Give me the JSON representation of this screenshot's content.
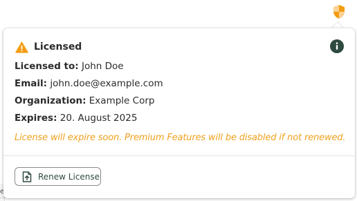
{
  "topbar": {
    "shield_icon": "shield-icon",
    "shield_color": "#f39c12"
  },
  "background": {
    "partial_text": "e"
  },
  "popover": {
    "title": "Licensed",
    "title_icon": "warning-triangle-icon",
    "title_icon_color": "#f39c12",
    "info_icon": "info-icon",
    "info_icon_color": "#2f4a3f",
    "fields": [
      {
        "label": "Licensed to:",
        "value": "John Doe"
      },
      {
        "label": "Email:",
        "value": "john.doe@example.com"
      },
      {
        "label": "Organization:",
        "value": "Example Corp"
      },
      {
        "label": "Expires:",
        "value": "20. August 2025"
      }
    ],
    "warning": "License will expire soon. Premium Features will be disabled if not renewed.",
    "warning_color": "#f0a11e",
    "renew_button": {
      "label": "Renew License",
      "icon": "upload-file-icon"
    }
  }
}
